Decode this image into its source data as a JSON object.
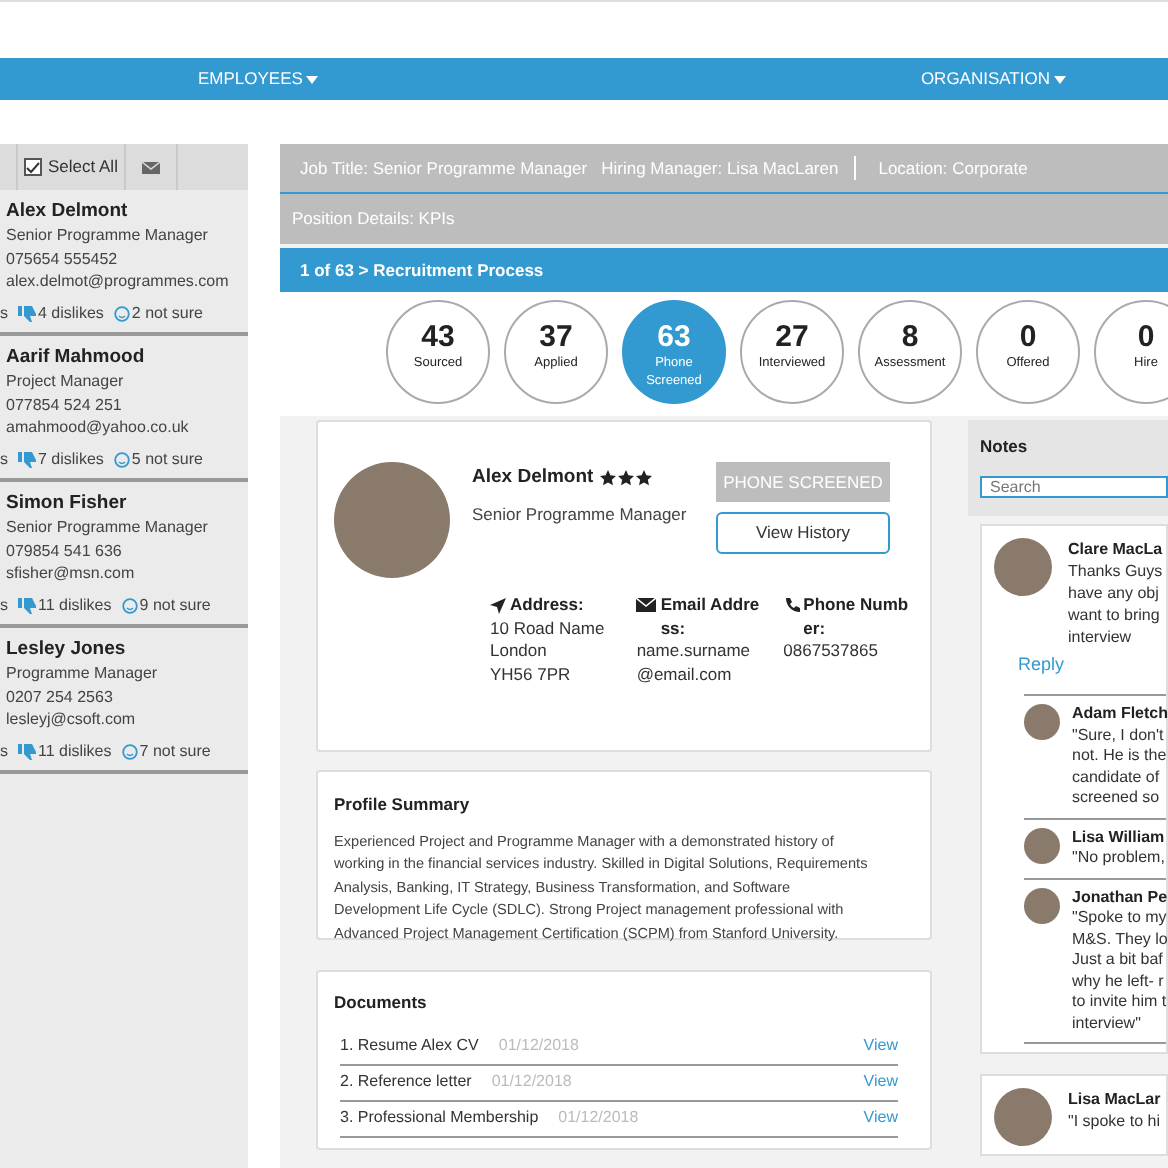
{
  "nav": [
    {
      "label": "EMPLOYEES",
      "caret": true
    },
    {
      "label": "ORGANISATION",
      "caret": true
    }
  ],
  "sidebar": {
    "select_all": {
      "label": "Select All",
      "checked": true
    },
    "candidates": [
      {
        "name": "Alex Delmont",
        "title": "Senior Programme Manager",
        "phone": "075654 555452",
        "email": "alex.delmot@programmes.com",
        "likes": "s",
        "dislikes": "4 dislikes",
        "not_sure": "2 not sure"
      },
      {
        "name": "Aarif Mahmood",
        "title": "Project Manager",
        "phone": "077854 524 251",
        "email": "amahmood@yahoo.co.uk",
        "likes": "s",
        "dislikes": "7 dislikes",
        "not_sure": "5 not sure"
      },
      {
        "name": "Simon Fisher",
        "title": "Senior Programme Manager",
        "phone": "079854 541 636",
        "email": "sfisher@msn.com",
        "likes": "s",
        "dislikes": "11 dislikes",
        "not_sure": "9 not sure"
      },
      {
        "name": "Lesley Jones",
        "title": "Programme Manager",
        "phone": "0207 254 2563",
        "email": "lesleyj@csoft.com",
        "likes": "s",
        "dislikes": "11 dislikes",
        "not_sure": "7 not sure"
      }
    ]
  },
  "job_bar": {
    "job_title": "Job Title: Senior Programme Manager",
    "hiring_manager": "Hiring Manager: Lisa MacLaren",
    "location": "Location: Corporate"
  },
  "position_details": "Position Details: KPIs",
  "breadcrumb": "1 of 63 > Recruitment Process",
  "stages": [
    {
      "count": "43",
      "label": "Sourced",
      "selected": false
    },
    {
      "count": "37",
      "label": "Applied",
      "selected": false
    },
    {
      "count": "63",
      "label": "Phone Screened",
      "selected": true
    },
    {
      "count": "27",
      "label": "Interviewed",
      "selected": false
    },
    {
      "count": "8",
      "label": "Assessment",
      "selected": false
    },
    {
      "count": "0",
      "label": "Offered",
      "selected": false
    },
    {
      "count": "0",
      "label": "Hire",
      "selected": false
    }
  ],
  "profile": {
    "name": "Alex Delmont",
    "stars": 3,
    "title": "Senior Programme Manager",
    "status": "PHONE SCREENED",
    "history_button": "View History",
    "contacts": [
      {
        "kind": "address",
        "heading": "Address:",
        "lines": [
          "10 Road Name",
          "London",
          "YH56 7PR"
        ]
      },
      {
        "kind": "email",
        "heading": "Email Address:",
        "lines": [
          "name.surname",
          "@email.com"
        ]
      },
      {
        "kind": "phone",
        "heading": "Phone Number:",
        "lines": [
          "0867537865"
        ]
      }
    ]
  },
  "summary": {
    "title": "Profile Summary",
    "text": "Experienced Project and Programme Manager with a demonstrated history of working in the financial services industry. Skilled in Digital Solutions, Requirements Analysis, Banking, IT Strategy, Business Transformation, and Software Development Life Cycle (SDLC). Strong Project management professional with Advanced Project Management Certification (SCPM) from Stanford University."
  },
  "documents": {
    "title": "Documents",
    "items": [
      {
        "name": "1. Resume Alex CV",
        "date": "01/12/2018",
        "action": "View"
      },
      {
        "name": "2. Reference letter",
        "date": "01/12/2018",
        "action": "View"
      },
      {
        "name": "3. Professional Membership",
        "date": "01/12/2018",
        "action": "View"
      }
    ]
  },
  "notes": {
    "title": "Notes",
    "search_placeholder": "Search",
    "threads": [
      {
        "author": "Clare MacLa",
        "lines": [
          "Thanks Guys",
          "have any obj",
          "want to bring",
          "interview"
        ],
        "reply": "Reply",
        "replies": [
          {
            "author": "Adam Fletch",
            "lines": [
              "\"Sure, I don't",
              "not. He is the",
              "candidate of",
              "screened so"
            ]
          },
          {
            "author": "Lisa William",
            "lines": [
              "\"No problem,"
            ]
          },
          {
            "author": "Jonathan Pe",
            "lines": [
              "\"Spoke to my",
              "M&S. They lo",
              "Just a bit baf",
              "why he left- r",
              "to invite him t",
              "interview\""
            ]
          }
        ]
      },
      {
        "author": "Lisa MacLar",
        "lines": [
          "\"I spoke to hi"
        ]
      }
    ]
  }
}
